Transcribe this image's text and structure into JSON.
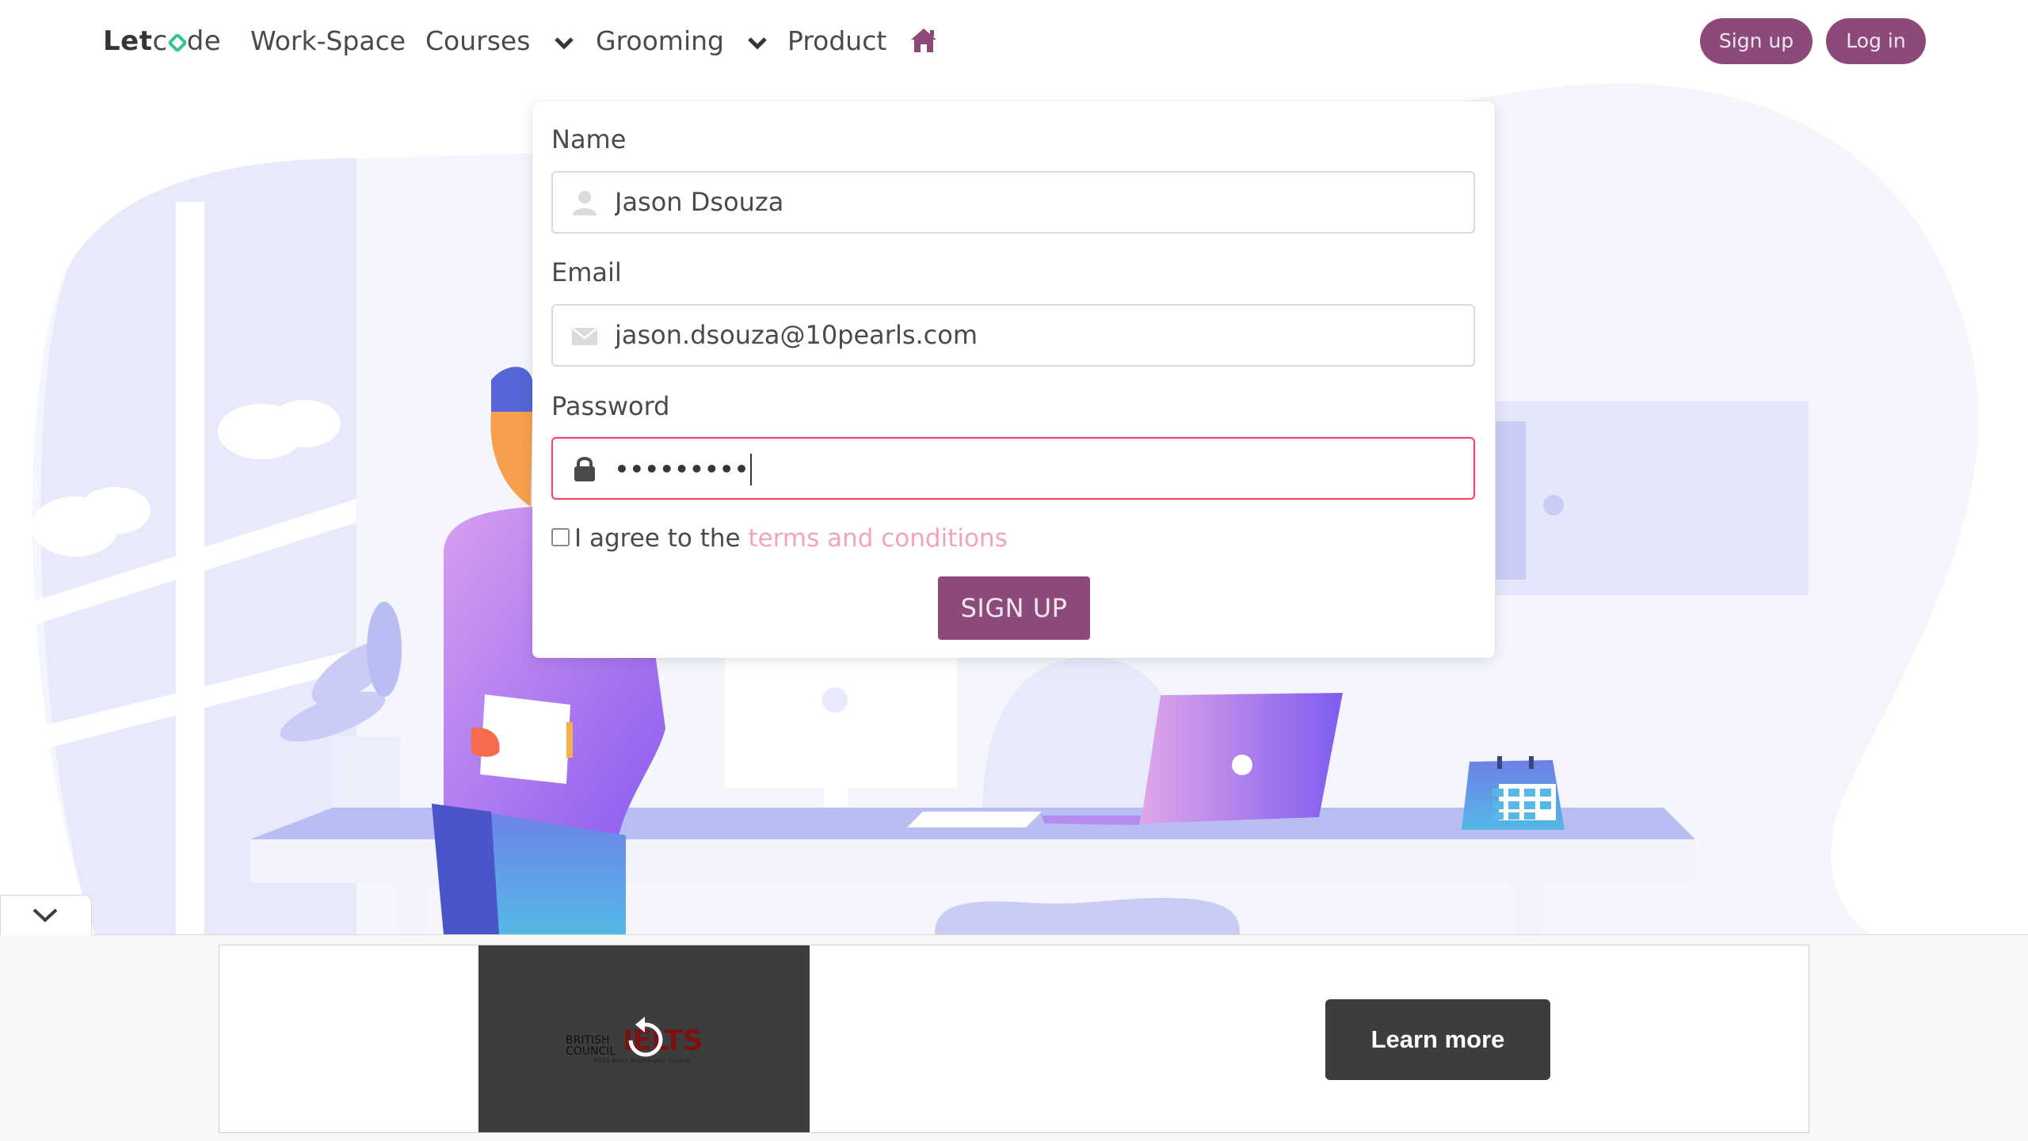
{
  "nav": {
    "logo_bold": "Let",
    "logo_rest": "de",
    "items": [
      {
        "label": "Work-Space"
      },
      {
        "label": "Courses"
      },
      {
        "label": "Grooming"
      },
      {
        "label": "Product"
      }
    ],
    "signup_label": "Sign up",
    "login_label": "Log in",
    "accent_color": "#8c4a7b"
  },
  "form": {
    "name_label": "Name",
    "name_value": "Jason Dsouza",
    "email_label": "Email",
    "email_value": "jason.dsouza@10pearls.com",
    "password_label": "Password",
    "password_value": "•••••••••",
    "agree_text": "I agree to the ",
    "terms_link": "terms and conditions",
    "submit_label": "SIGN UP",
    "error_border_color": "#f14668"
  },
  "ad": {
    "brand_left": "BRITISH COUNCIL",
    "brand_right": "IELTS",
    "tagline": "IELTS Band Accelerator Course",
    "cta_label": "Learn more"
  },
  "icons": {
    "home": "home-icon",
    "name_field": "user-icon",
    "email_field": "envelope-icon",
    "password_field": "lock-icon",
    "dropdown": "chevron-down-icon",
    "ad_toggle": "chevron-down-icon",
    "replay": "replay-icon"
  }
}
